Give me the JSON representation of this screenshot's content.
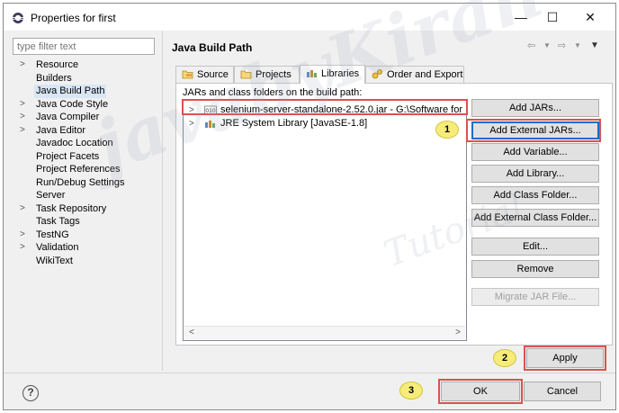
{
  "window": {
    "title": "Properties for first",
    "minimize": "—",
    "maximize": "☐",
    "close": "✕"
  },
  "filter": {
    "placeholder": "type filter text"
  },
  "tree": {
    "items": [
      {
        "label": "Resource",
        "expandable": true
      },
      {
        "label": "Builders",
        "expandable": false
      },
      {
        "label": "Java Build Path",
        "expandable": false,
        "selected": true
      },
      {
        "label": "Java Code Style",
        "expandable": true
      },
      {
        "label": "Java Compiler",
        "expandable": true
      },
      {
        "label": "Java Editor",
        "expandable": true
      },
      {
        "label": "Javadoc Location",
        "expandable": false
      },
      {
        "label": "Project Facets",
        "expandable": false
      },
      {
        "label": "Project References",
        "expandable": false
      },
      {
        "label": "Run/Debug Settings",
        "expandable": false
      },
      {
        "label": "Server",
        "expandable": false
      },
      {
        "label": "Task Repository",
        "expandable": true
      },
      {
        "label": "Task Tags",
        "expandable": false
      },
      {
        "label": "TestNG",
        "expandable": true
      },
      {
        "label": "Validation",
        "expandable": true
      },
      {
        "label": "WikiText",
        "expandable": false
      }
    ]
  },
  "page": {
    "title": "Java Build Path",
    "tabs": [
      "Source",
      "Projects",
      "Libraries",
      "Order and Export"
    ],
    "active_tab": "Libraries",
    "list_label": "JARs and class folders on the build path:",
    "libraries": [
      {
        "label": "selenium-server-standalone-2.52.0.jar - G:\\Software for"
      },
      {
        "label": "JRE System Library [JavaSE-1.8]"
      }
    ],
    "buttons": {
      "add_jars": "Add JARs...",
      "add_external_jars": "Add External JARs...",
      "add_variable": "Add Variable...",
      "add_library": "Add Library...",
      "add_class_folder": "Add Class Folder...",
      "add_external_class_folder": "Add External Class Folder...",
      "edit": "Edit...",
      "remove": "Remove",
      "migrate_jar": "Migrate JAR File..."
    }
  },
  "footer": {
    "apply": "Apply",
    "ok": "OK",
    "cancel": "Cancel",
    "help": "?"
  },
  "callouts": [
    "1",
    "2",
    "3"
  ],
  "watermark": {
    "main": "javabyKiran",
    "sub": "Tutorial"
  },
  "colors": {
    "highlight_box": "#d9534f",
    "callout_fill": "#f7ec7a",
    "focus_border": "#0a6fd0",
    "selection": "#d8e6f5"
  }
}
